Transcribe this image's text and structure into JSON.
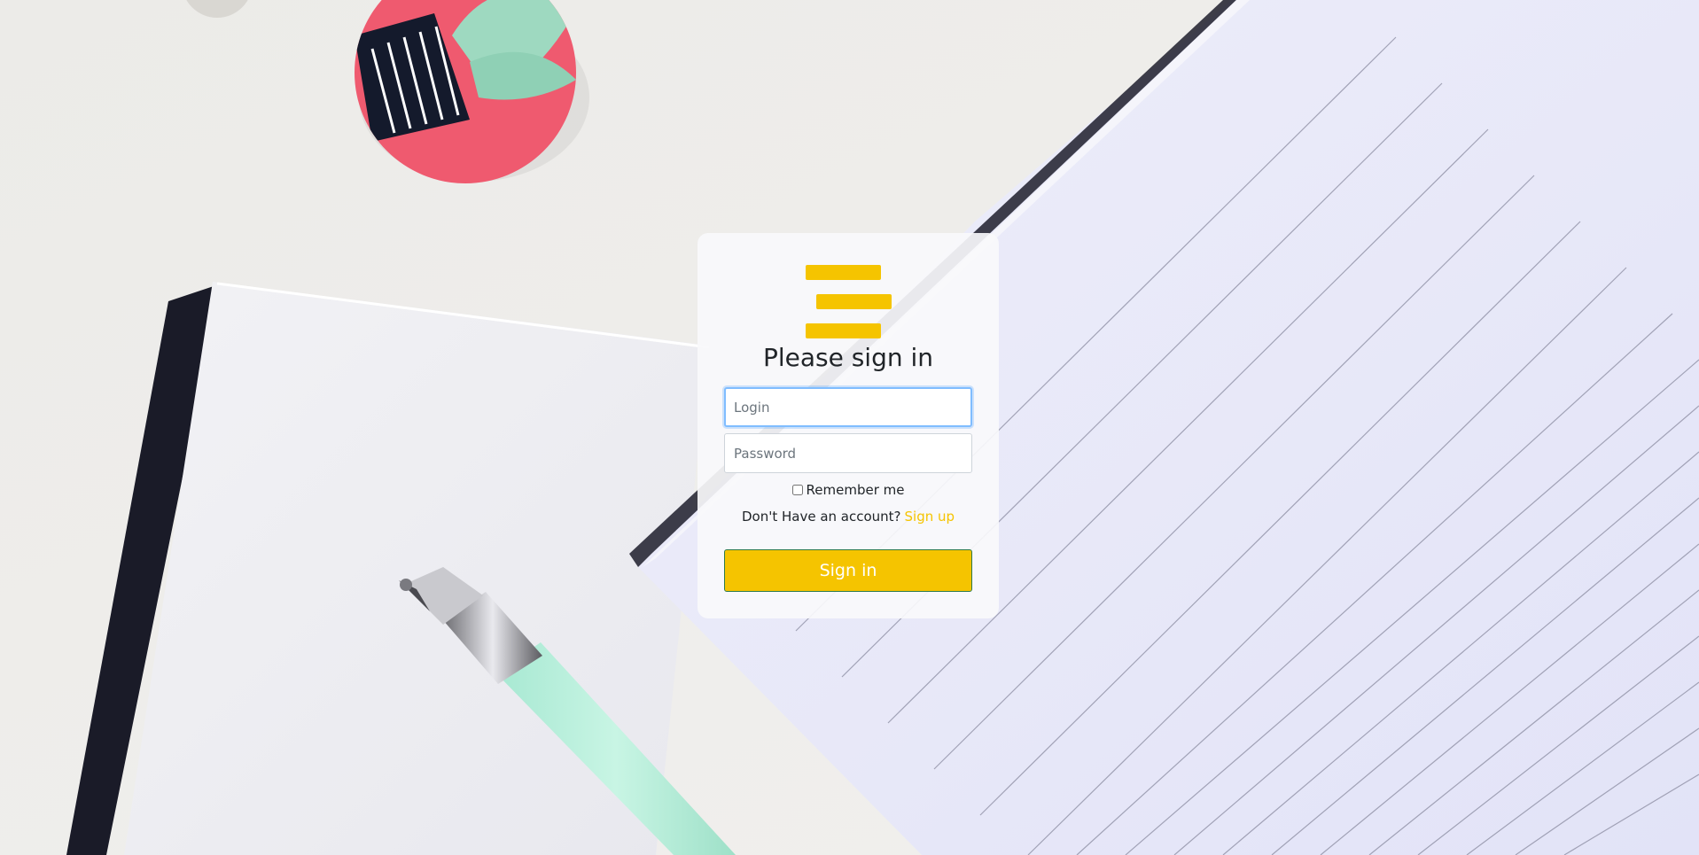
{
  "background": {
    "description_icon": "desk-notebook-pen-photo"
  },
  "logo": {
    "icon": "three-bars-logo-icon",
    "color": "#f5c400"
  },
  "form": {
    "heading": "Please sign in",
    "login_placeholder": "Login",
    "password_placeholder": "Password",
    "remember_label": "Remember me",
    "remember_checked": false,
    "signup_prompt": "Don't Have an account?",
    "signup_link": "Sign up",
    "submit_label": "Sign in"
  },
  "colors": {
    "accent": "#f5c400",
    "focus_border": "#80bdff",
    "button_border": "#2f7a4c"
  }
}
